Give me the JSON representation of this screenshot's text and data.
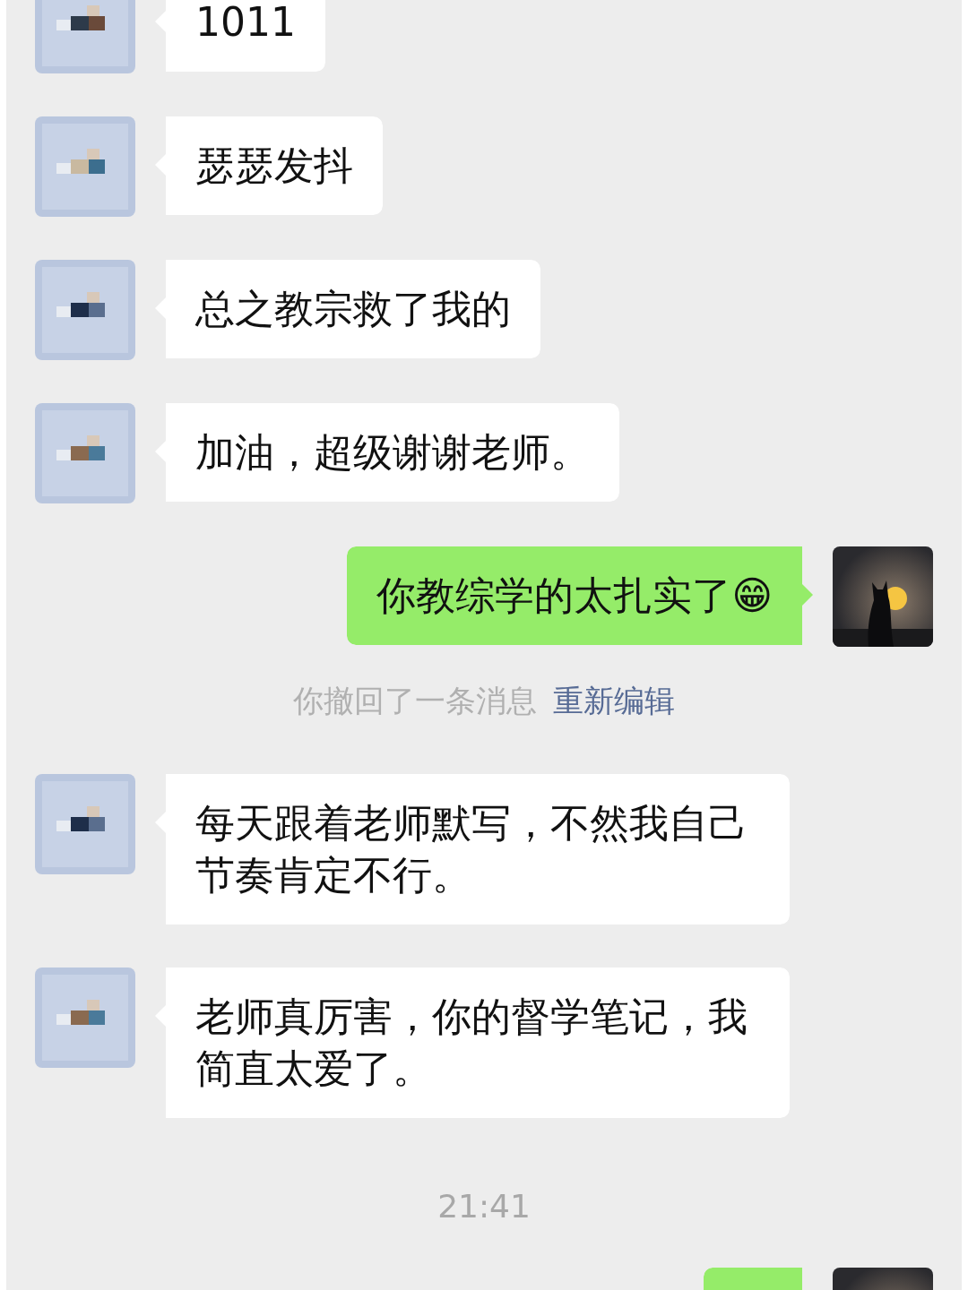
{
  "messages": [
    {
      "kind": "incoming",
      "text": "1011"
    },
    {
      "kind": "incoming",
      "text": "瑟瑟发抖"
    },
    {
      "kind": "incoming",
      "text": "总之教宗救了我的"
    },
    {
      "kind": "incoming",
      "text": "加油，超级谢谢老师。"
    },
    {
      "kind": "outgoing",
      "text": "你教综学的太扎实了😁"
    },
    {
      "kind": "system",
      "text": "你撤回了一条消息",
      "link": "重新编辑"
    },
    {
      "kind": "incoming",
      "text": "每天跟着老师默写，不然我自己节奏肯定不行。"
    },
    {
      "kind": "incoming",
      "text": "老师真厉害，你的督学笔记，我简直太爱了。"
    },
    {
      "kind": "time",
      "text": "21:41"
    },
    {
      "kind": "outgoing_cut"
    }
  ]
}
